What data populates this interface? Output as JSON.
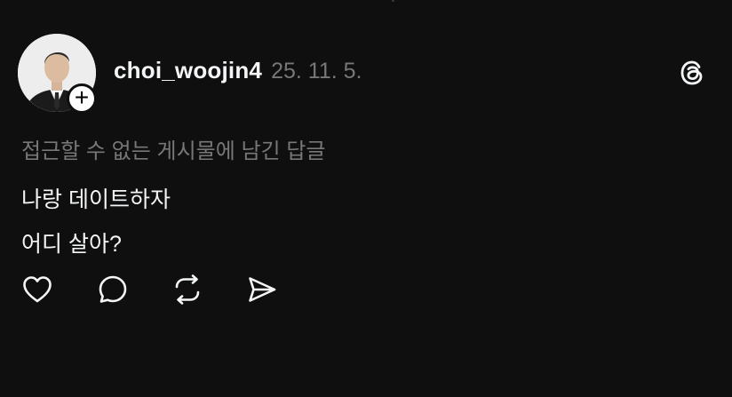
{
  "post": {
    "username": "choi_woojin4",
    "timestamp": "25. 11. 5.",
    "context_note": "접근할 수 없는 게시물에 남긴 답글",
    "lines": [
      "나랑 데이트하자",
      "어디 살아?"
    ]
  },
  "follow_badge": {
    "symbol": "+"
  },
  "icons": {
    "logo": "threads-logo-icon",
    "like": "heart-icon",
    "reply": "comment-icon",
    "repost": "repost-icon",
    "share": "send-icon"
  },
  "colors": {
    "background": "#0f0f0f",
    "primary_text": "#f3f5f7",
    "secondary_text": "#777777"
  }
}
